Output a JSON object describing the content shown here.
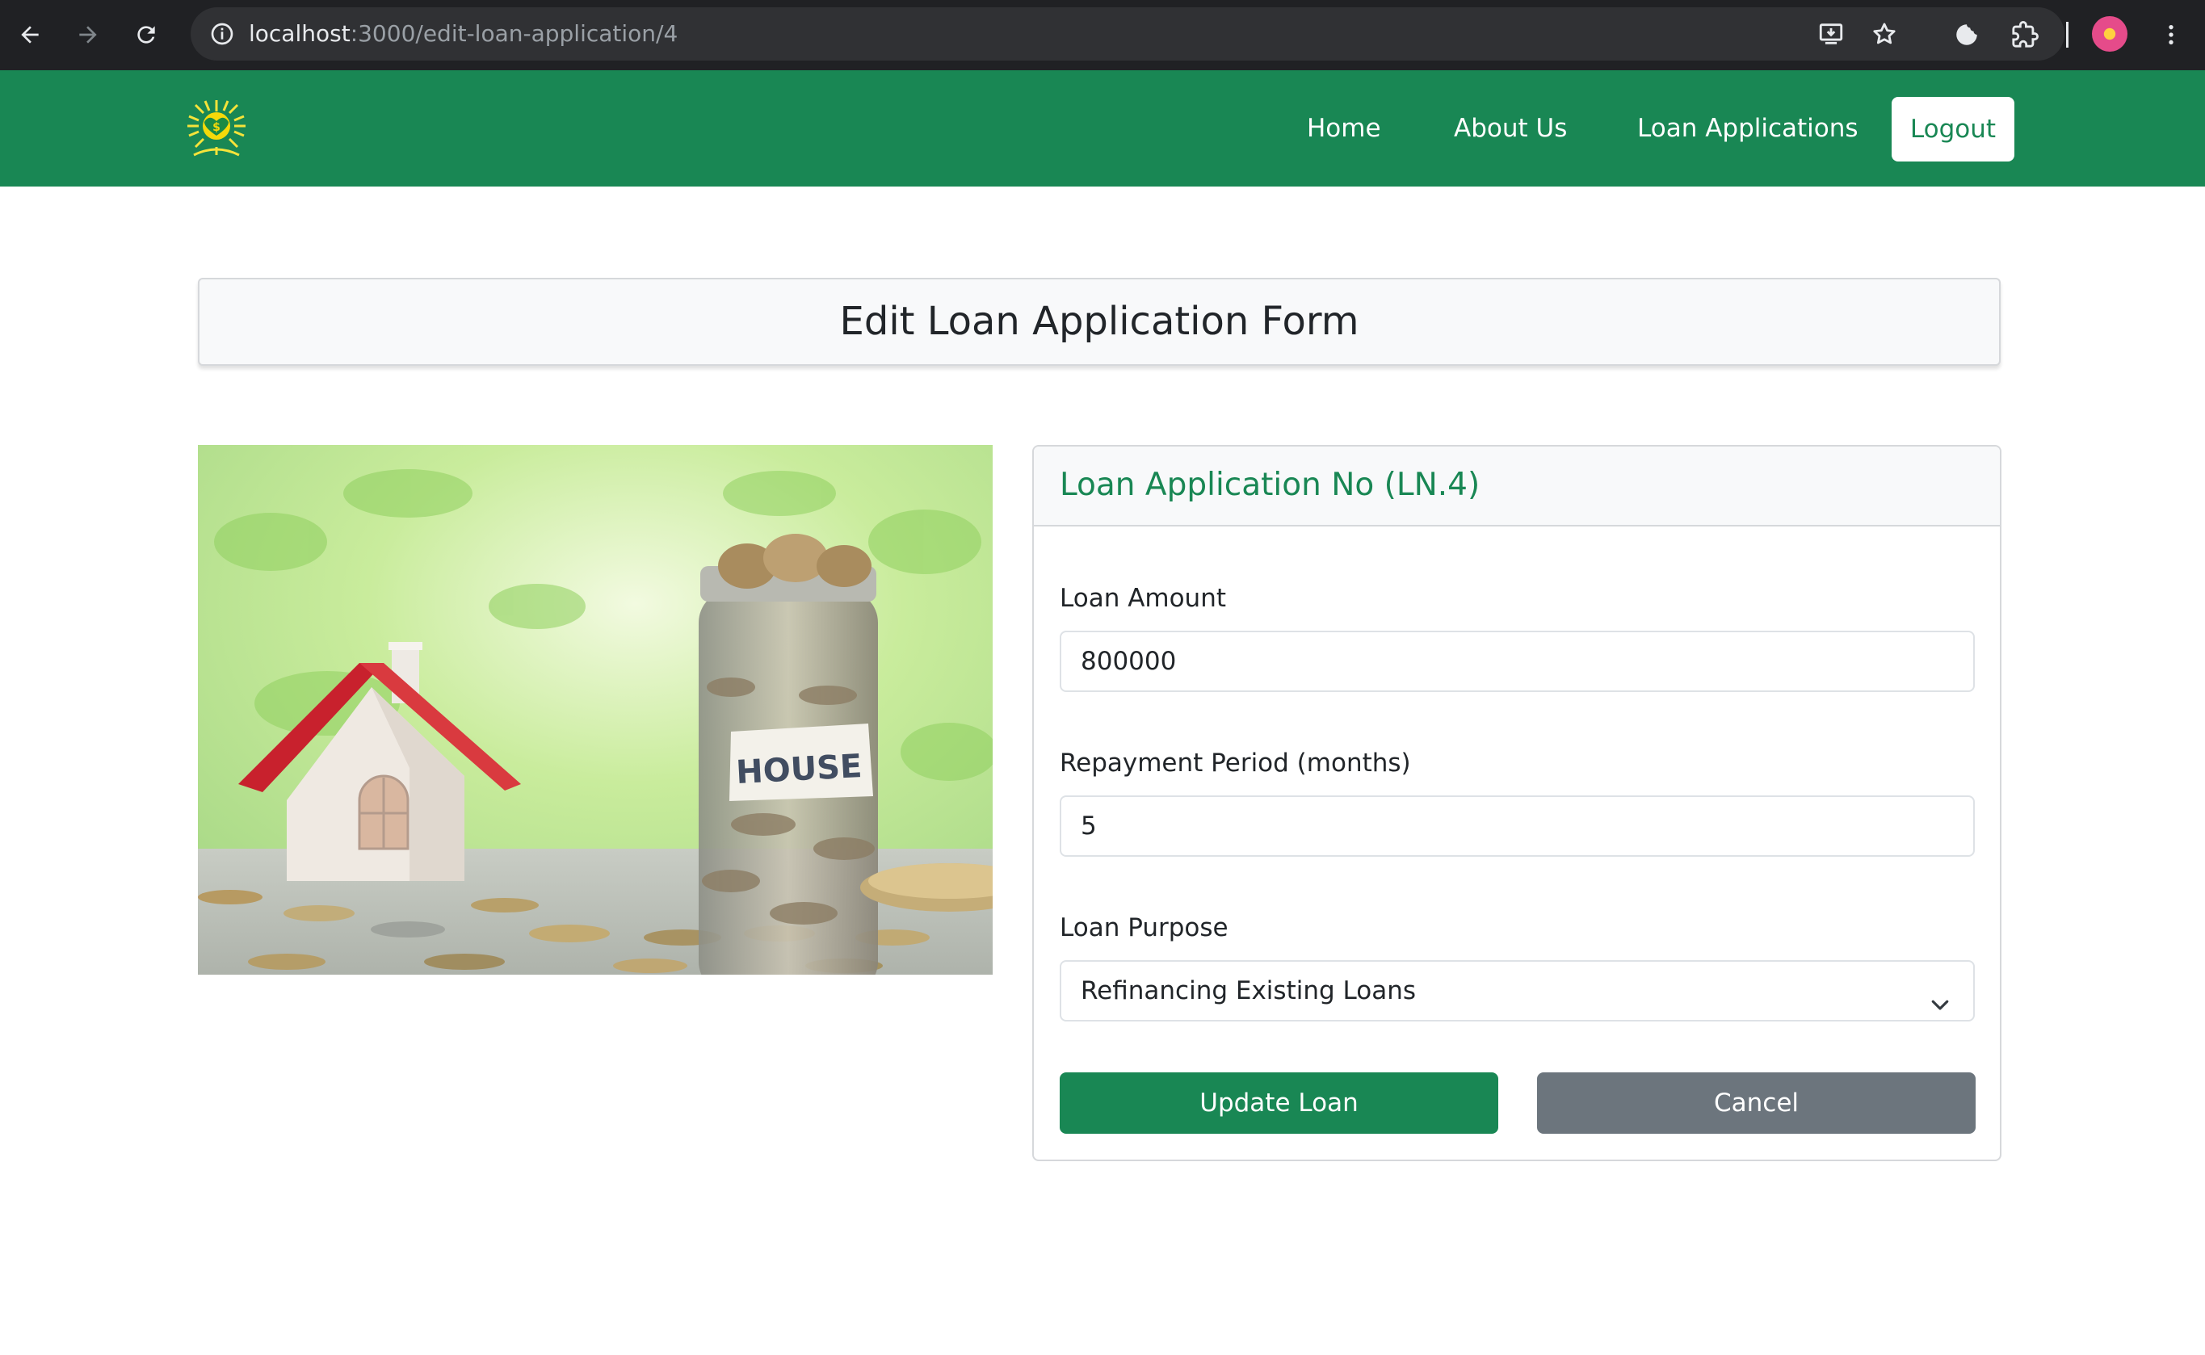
{
  "browser": {
    "url_host": "localhost",
    "url_path": ":3000/edit-loan-application/4",
    "icons": [
      "back-arrow-icon",
      "forward-arrow-icon",
      "reload-icon",
      "site-info-icon",
      "install-app-icon",
      "bookmark-star-icon",
      "extension-puzzle-icon",
      "profile-avatar",
      "menu-kebab-icon"
    ]
  },
  "navbar": {
    "logo_icon": "sun-dollar-logo-icon",
    "links": [
      "Home",
      "About Us",
      "Loan Applications"
    ],
    "logout_label": "Logout",
    "color": "#198754"
  },
  "page": {
    "title": "Edit Loan Application Form"
  },
  "hero_image": {
    "text": "HOUSE"
  },
  "form": {
    "header": "Loan Application No (LN.4)",
    "fields": {
      "loan_amount": {
        "label": "Loan Amount",
        "value": "800000"
      },
      "repayment_period": {
        "label": "Repayment Period (months)",
        "value": "5"
      },
      "loan_purpose": {
        "label": "Loan Purpose",
        "value": "Refinancing Existing Loans"
      }
    },
    "update_label": "Update Loan",
    "cancel_label": "Cancel"
  },
  "colors": {
    "primary_green": "#198754",
    "secondary_gray": "#6c757d",
    "chrome_dark": "#202124"
  }
}
